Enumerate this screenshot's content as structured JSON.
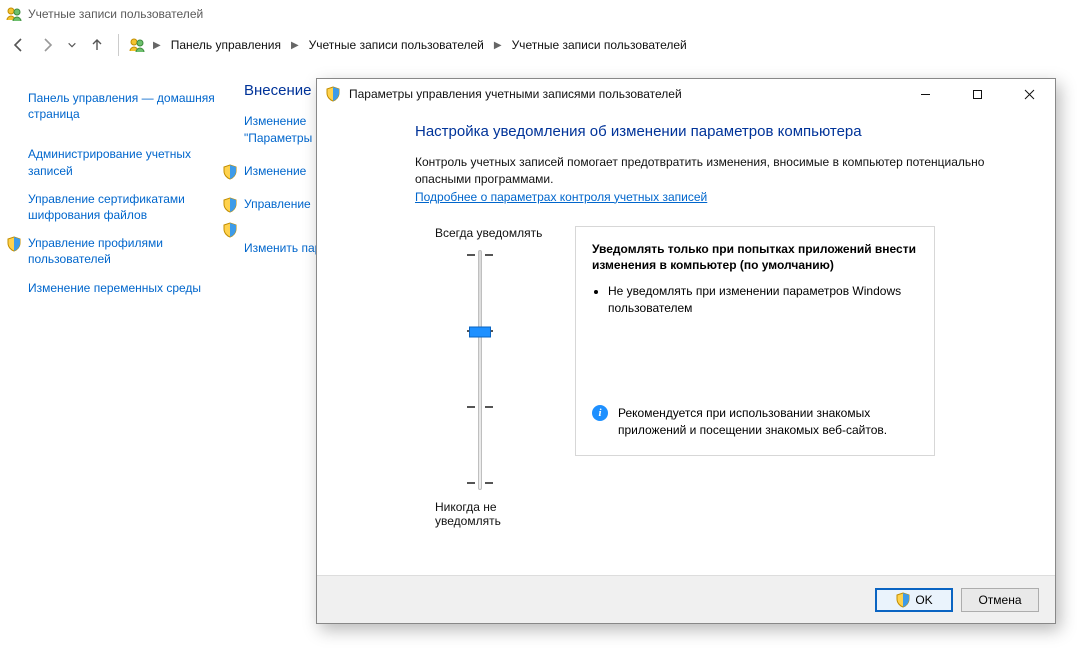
{
  "window": {
    "title": "Учетные записи пользователей"
  },
  "breadcrumb": {
    "root": "Панель управления",
    "level1": "Учетные записи пользователей",
    "level2": "Учетные записи пользователей"
  },
  "sidebar": {
    "home": "Панель управления — домашняя страница",
    "admin": "Администрирование учетных записей",
    "certs": "Управление сертификатами шифрования файлов",
    "profiles": "Управление профилями пользователей",
    "env": "Изменение переменных среды"
  },
  "content": {
    "heading": "Внесение из",
    "link1_line1": "Изменение",
    "link1_line2": "\"Параметры",
    "link2": "Изменение",
    "link3": "Управление",
    "link4": "Изменить пара"
  },
  "dialog": {
    "title": "Параметры управления учетными записями пользователей",
    "heading": "Настройка уведомления об изменении параметров компьютера",
    "para": "Контроль учетных записей помогает предотвратить изменения, вносимые в компьютер потенциально опасными программами.",
    "link": "Подробнее о параметрах контроля учетных записей",
    "slider_top": "Всегда уведомлять",
    "slider_bottom": "Никогда не уведомлять",
    "info_title": "Уведомлять только при попытках приложений внести изменения в компьютер (по умолчанию)",
    "info_bullet1": "Не уведомлять при изменении параметров Windows пользователем",
    "info_reco": "Рекомендуется при использовании знакомых приложений и посещении знакомых веб-сайтов.",
    "ok": "OK",
    "cancel": "Отмена"
  }
}
